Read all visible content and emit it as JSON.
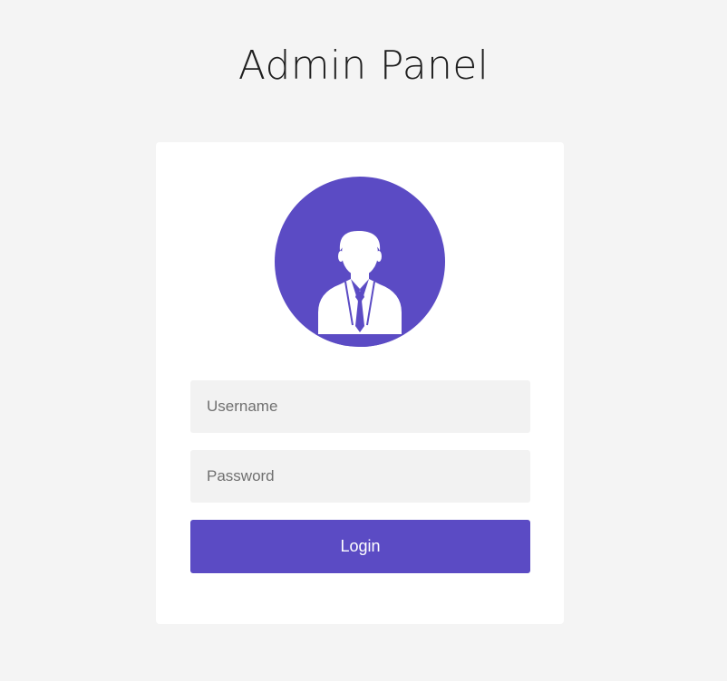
{
  "page": {
    "title": "Admin Panel"
  },
  "login_form": {
    "avatar_icon": "user-tie-icon",
    "username": {
      "placeholder": "Username",
      "value": ""
    },
    "password": {
      "placeholder": "Password",
      "value": ""
    },
    "submit_label": "Login"
  },
  "colors": {
    "accent": "#5b4bc4",
    "page_background": "#f4f4f4",
    "card_background": "#ffffff",
    "input_background": "#f2f2f2"
  }
}
